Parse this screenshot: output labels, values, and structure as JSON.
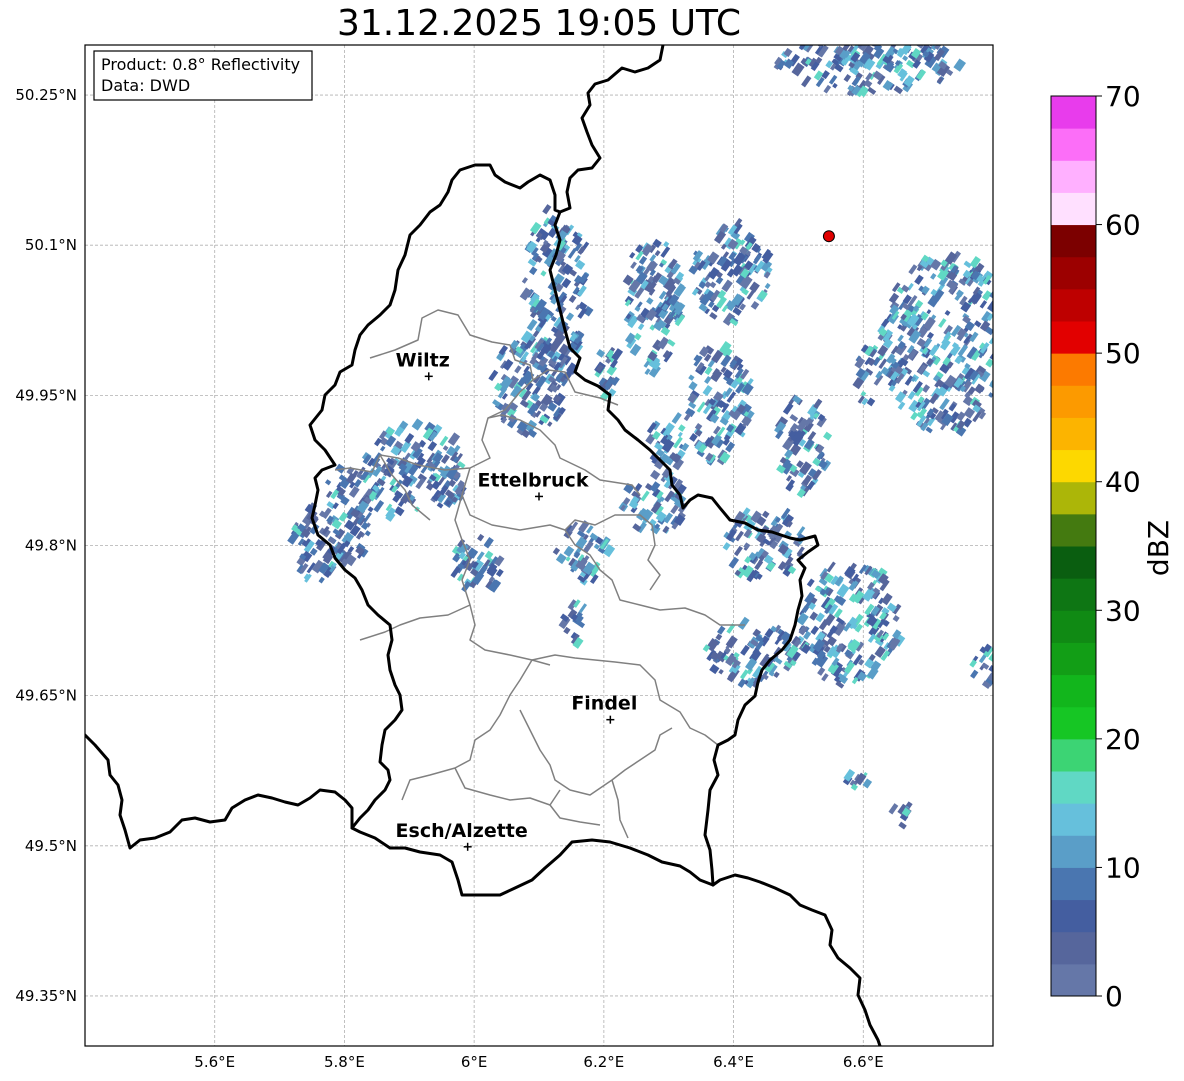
{
  "title": "31.12.2025 19:05 UTC",
  "info_box": {
    "product": "Product: 0.8° Reflectivity",
    "data": "Data: DWD"
  },
  "axes": {
    "lon_ticks": [
      "5.6°E",
      "5.8°E",
      "6°E",
      "6.2°E",
      "6.4°E",
      "6.6°E"
    ],
    "lon_values": [
      5.6,
      5.8,
      6.0,
      6.2,
      6.4,
      6.6
    ],
    "lat_ticks": [
      "50.25°N",
      "50.1°N",
      "49.95°N",
      "49.8°N",
      "49.65°N",
      "49.5°N",
      "49.35°N"
    ],
    "lat_values": [
      50.25,
      50.1,
      49.95,
      49.8,
      49.65,
      49.5,
      49.35
    ],
    "lon_range": [
      5.4,
      6.8
    ],
    "lat_range": [
      49.3,
      50.3
    ],
    "grid": true
  },
  "cities": [
    {
      "name": "Wiltz",
      "lon": 5.93,
      "lat": 49.969
    },
    {
      "name": "Ettelbruck",
      "lon": 6.1,
      "lat": 49.849
    },
    {
      "name": "Findel",
      "lon": 6.21,
      "lat": 49.626
    },
    {
      "name": "Esch/Alzette",
      "lon": 5.99,
      "lat": 49.499
    }
  ],
  "radar_site": {
    "lon": 6.547,
    "lat": 50.109,
    "color": "#e00000"
  },
  "colorbar": {
    "label": "dBZ",
    "ticks": [
      "0",
      "10",
      "20",
      "30",
      "40",
      "50",
      "60",
      "70"
    ],
    "min": 0,
    "max": 70,
    "step": 2.5,
    "colors": [
      "#6577a8",
      "#56669c",
      "#445ea0",
      "#4a76b0",
      "#5a9ec8",
      "#66c0dc",
      "#60d8c4",
      "#3cd474",
      "#16c624",
      "#12b61c",
      "#129e16",
      "#108a14",
      "#0e7614",
      "#0a5e10",
      "#447a10",
      "#acb608",
      "#fdd800",
      "#fcb400",
      "#fc9a00",
      "#fc7a00",
      "#e20000",
      "#be0000",
      "#9c0000",
      "#7c0000",
      "#ffe0ff",
      "#ffb0ff",
      "#fc6ef8",
      "#e83cec"
    ]
  },
  "radar_cells": [
    {
      "lon": 6.12,
      "lat": 50.05,
      "dlon": 0.05,
      "dlat": 0.09,
      "level": 2,
      "hot": 2
    },
    {
      "lon": 6.27,
      "lat": 50.04,
      "dlon": 0.045,
      "dlat": 0.07,
      "level": 2,
      "hot": 3
    },
    {
      "lon": 6.39,
      "lat": 50.07,
      "dlon": 0.06,
      "dlat": 0.05,
      "level": 3,
      "hot": 2
    },
    {
      "lon": 6.37,
      "lat": 49.94,
      "dlon": 0.05,
      "dlat": 0.06,
      "level": 2,
      "hot": 3
    },
    {
      "lon": 6.08,
      "lat": 49.96,
      "dlon": 0.06,
      "dlat": 0.05,
      "level": 2,
      "hot": 2
    },
    {
      "lon": 5.9,
      "lat": 49.87,
      "dlon": 0.08,
      "dlat": 0.05,
      "level": 3,
      "hot": 2
    },
    {
      "lon": 5.75,
      "lat": 49.8,
      "dlon": 0.04,
      "dlat": 0.04,
      "level": 2,
      "hot": 1
    },
    {
      "lon": 5.8,
      "lat": 49.83,
      "dlon": 0.04,
      "dlat": 0.05,
      "level": 2,
      "hot": 1
    },
    {
      "lon": 6.0,
      "lat": 49.78,
      "dlon": 0.04,
      "dlat": 0.03,
      "level": 2,
      "hot": 2
    },
    {
      "lon": 6.16,
      "lat": 49.79,
      "dlon": 0.04,
      "dlat": 0.03,
      "level": 3,
      "hot": 3
    },
    {
      "lon": 6.27,
      "lat": 49.84,
      "dlon": 0.05,
      "dlat": 0.03,
      "level": 2,
      "hot": 3
    },
    {
      "lon": 6.44,
      "lat": 49.8,
      "dlon": 0.06,
      "dlat": 0.04,
      "level": 3,
      "hot": 2
    },
    {
      "lon": 6.57,
      "lat": 49.72,
      "dlon": 0.08,
      "dlat": 0.06,
      "level": 3,
      "hot": 3
    },
    {
      "lon": 6.42,
      "lat": 49.69,
      "dlon": 0.08,
      "dlat": 0.03,
      "level": 2,
      "hot": 2
    },
    {
      "lon": 6.72,
      "lat": 50.0,
      "dlon": 0.1,
      "dlat": 0.09,
      "level": 3,
      "hot": 3
    },
    {
      "lon": 6.5,
      "lat": 49.9,
      "dlon": 0.04,
      "dlat": 0.05,
      "level": 2,
      "hot": 2
    },
    {
      "lon": 6.29,
      "lat": 49.9,
      "dlon": 0.03,
      "dlat": 0.03,
      "level": 2,
      "hot": 3
    },
    {
      "lon": 6.6,
      "lat": 50.28,
      "dlon": 0.14,
      "dlat": 0.03,
      "level": 2,
      "hot": 2
    },
    {
      "lon": 6.2,
      "lat": 49.97,
      "dlon": 0.02,
      "dlat": 0.03,
      "level": 2,
      "hot": 1
    },
    {
      "lon": 6.15,
      "lat": 49.72,
      "dlon": 0.02,
      "dlat": 0.02,
      "level": 2,
      "hot": 1
    },
    {
      "lon": 6.78,
      "lat": 49.68,
      "dlon": 0.02,
      "dlat": 0.02,
      "level": 2,
      "hot": 1
    },
    {
      "lon": 6.6,
      "lat": 49.97,
      "dlon": 0.02,
      "dlat": 0.03,
      "level": 2,
      "hot": 3
    },
    {
      "lon": 6.58,
      "lat": 49.56,
      "dlon": 0.02,
      "dlat": 0.01,
      "level": 2,
      "hot": 1
    },
    {
      "lon": 6.65,
      "lat": 49.53,
      "dlon": 0.02,
      "dlat": 0.01,
      "level": 2,
      "hot": 1
    }
  ]
}
